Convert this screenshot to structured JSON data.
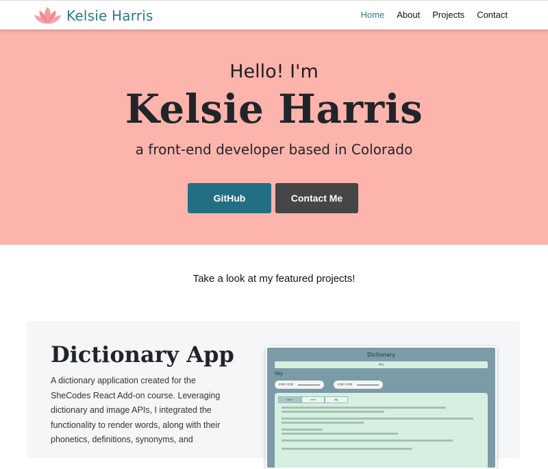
{
  "navbar": {
    "brand_name": "Kelsie Harris",
    "links": [
      {
        "label": "Home",
        "active": true
      },
      {
        "label": "About",
        "active": false
      },
      {
        "label": "Projects",
        "active": false
      },
      {
        "label": "Contact",
        "active": false
      }
    ]
  },
  "hero": {
    "greeting": "Hello! I'm",
    "name": "Kelsie Harris",
    "tagline": "a front-end developer based in Colorado",
    "github_button": "GitHub",
    "contact_button": "Contact Me"
  },
  "featured": {
    "intro": "Take a look at my featured projects!"
  },
  "project": {
    "title": "Dictionary App",
    "description": "A dictionary application created for the SheCodes React Add-on course. Leveraging dictionary and image APIs, I integrated the functionality to render words, along with their phonetics, definitions, synonyms, and",
    "screenshot": {
      "title": "Dictionary",
      "search_value": "sky",
      "word": "Sky",
      "audio_1": "0:00 / 0:00",
      "audio_2": "0:00 / 0:00",
      "tabs": [
        "noun",
        "verb",
        "adj."
      ]
    }
  },
  "colors": {
    "hero_bg": "#fdb4ad",
    "brand": "#2b7a86",
    "github_button": "#226f83",
    "contact_button": "#464646",
    "project_bg": "#f5f6f7"
  },
  "icons": {
    "brand_logo": "lotus-flower-icon"
  }
}
